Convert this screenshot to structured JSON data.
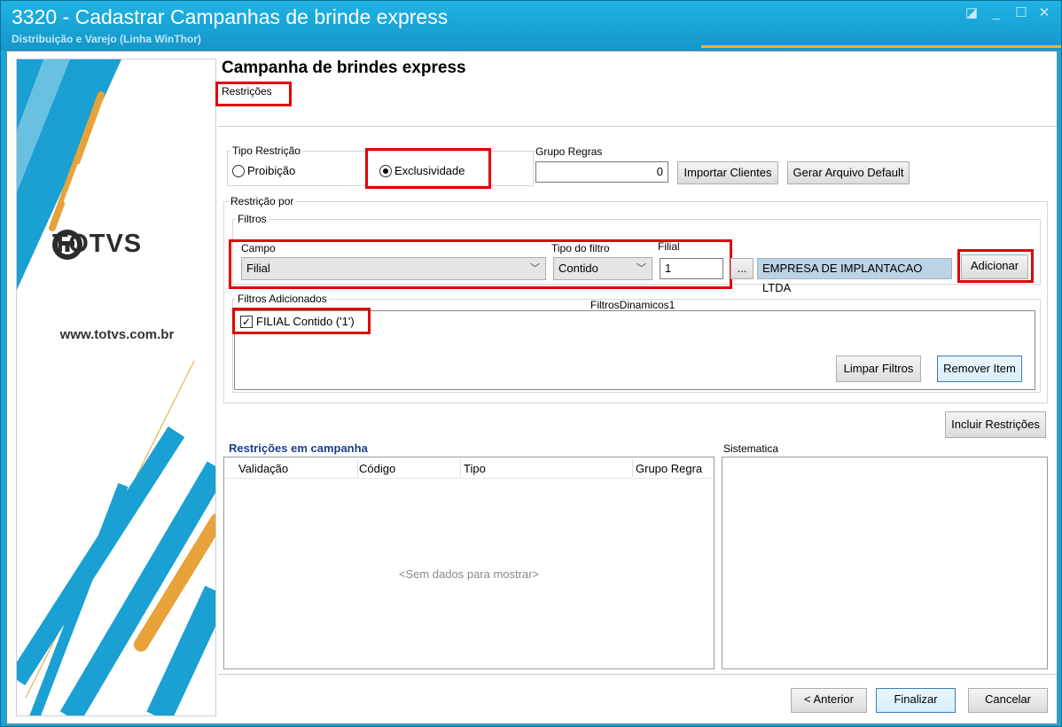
{
  "window": {
    "title": "3320 - Cadastrar Campanhas de brinde express",
    "subtitle": "Distribuição e Varejo (Linha WinThor)"
  },
  "banner": {
    "logo_text": "TOTVS",
    "website": "www.totvs.com.br"
  },
  "page": {
    "title": "Campanha de brindes express",
    "step": "Restrições"
  },
  "tipo_restricao": {
    "label": "Tipo Restrição",
    "options": [
      "Proibição",
      "Exclusividade"
    ],
    "selected": "Exclusividade"
  },
  "grupo_regras": {
    "label": "Grupo Regras",
    "value": "0"
  },
  "buttons": {
    "importar_clientes": "Importar Clientes",
    "gerar_arquivo": "Gerar Arquivo Default",
    "adicionar": "Adicionar",
    "limpar_filtros": "Limpar Filtros",
    "remover_item": "Remover Item",
    "incluir_restricoes": "Incluir Restrições",
    "anterior": "< Anterior",
    "finalizar": "Finalizar",
    "cancelar": "Cancelar",
    "ellipsis": "..."
  },
  "restricao_por": {
    "label": "Restrição por",
    "filtros_label": "Filtros",
    "campo_label": "Campo",
    "campo_value": "Filial",
    "tipo_filtro_label": "Tipo do filtro",
    "tipo_filtro_value": "Contido",
    "filial_label": "Filial",
    "filial_value": "1",
    "empresa_value": "EMPRESA DE IMPLANTACAO LTDA"
  },
  "filtros_adicionados": {
    "label": "Filtros Adicionados",
    "component_name": "FiltrosDinamicos1",
    "items": [
      {
        "label": "FILIAL Contido ('1')",
        "checked": true
      }
    ]
  },
  "restricoes_campanha": {
    "title": "Restrições em campanha",
    "columns": [
      "Validação",
      "Código",
      "Tipo",
      "Grupo Regra"
    ],
    "empty_text": "<Sem dados para mostrar>"
  },
  "sistematica": {
    "label": "Sistematica"
  },
  "colors": {
    "titlebar": "#1aa5d6",
    "highlight": "#e00000",
    "section_title": "#1c3f8c"
  }
}
